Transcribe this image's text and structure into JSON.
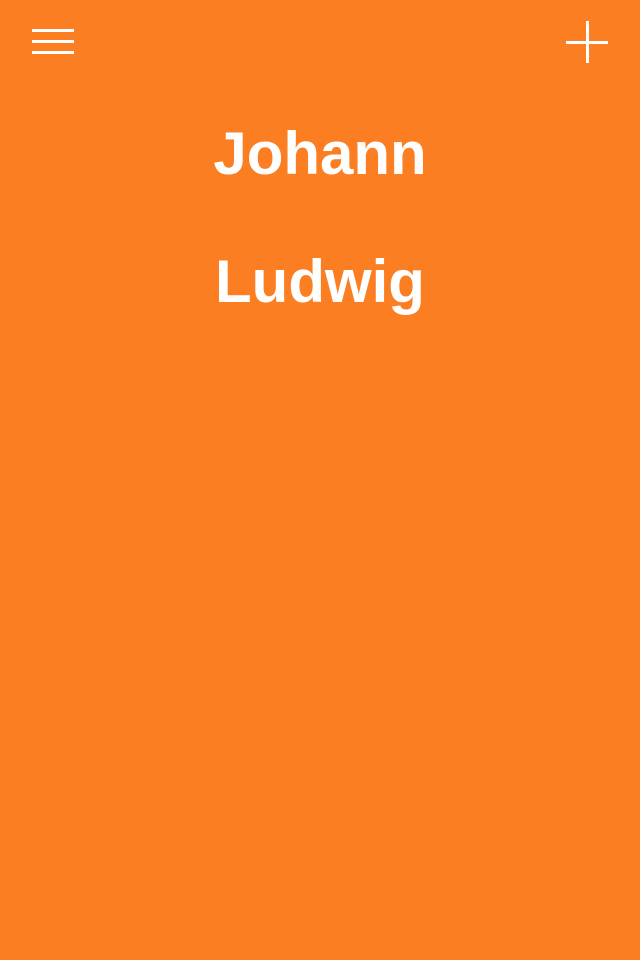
{
  "header": {
    "menu_icon": "hamburger-menu-icon",
    "add_icon": "plus-icon"
  },
  "names": [
    {
      "label": "Johann"
    },
    {
      "label": "Ludwig"
    }
  ],
  "colors": {
    "background": "#FC7E22",
    "foreground": "#FFFFFF"
  }
}
